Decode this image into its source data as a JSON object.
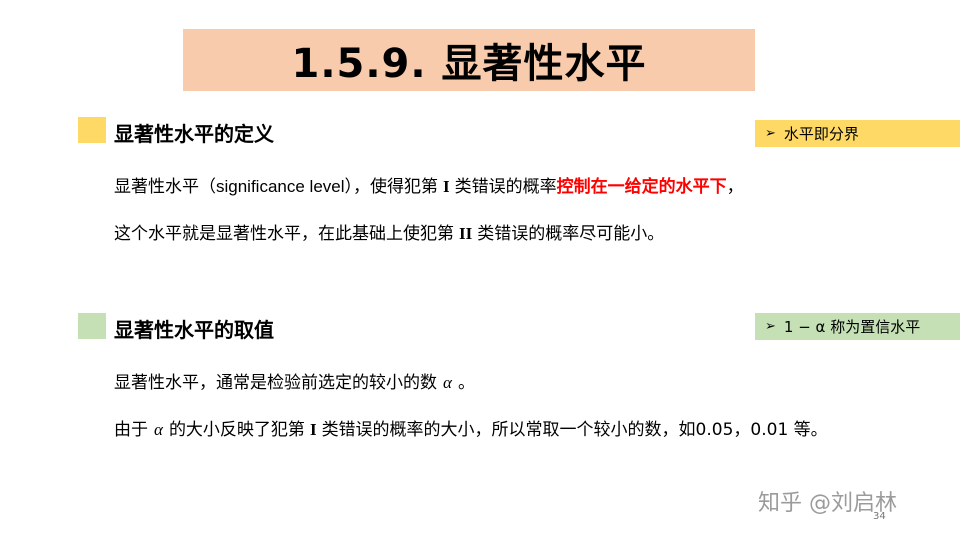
{
  "title": "1.5.9. 显著性水平",
  "colors": {
    "title_bg": "#f8cbad",
    "section1_marker": "#ffd966",
    "section1_side_bg": "#ffd966",
    "section2_marker": "#c5e0b4",
    "section2_side_bg": "#c5e0b4",
    "highlight": "#ff0000"
  },
  "section1": {
    "heading": "显著性水平的定义",
    "side_note": "水平即分界",
    "line1": {
      "part1": "显著性水平（",
      "term": "significance level",
      "part2": "），使得犯第",
      "roman": "I",
      "part3": "类错误的概率",
      "highlight": "控制在一给定的水平下",
      "part4": "，"
    },
    "line2": {
      "part1": "这个水平就是显著性水平，在此基础上使犯第",
      "roman": "II",
      "part2": "类错误的概率尽可能小。"
    }
  },
  "section2": {
    "heading": "显著性水平的取值",
    "side_note": "1 − α 称为置信水平",
    "line1": {
      "part1": "显著性水平，通常是检验前选定的较小的数",
      "greek": "α",
      "part2": "。"
    },
    "line2": {
      "part1": "由于",
      "greek": "α",
      "part2": "的大小反映了犯第",
      "roman": "I",
      "part3": "类错误的概率的大小，所以常取一个较小的数，如0.05，0.01 等。"
    }
  },
  "watermark": "知乎 @刘启林",
  "page_number": "34"
}
